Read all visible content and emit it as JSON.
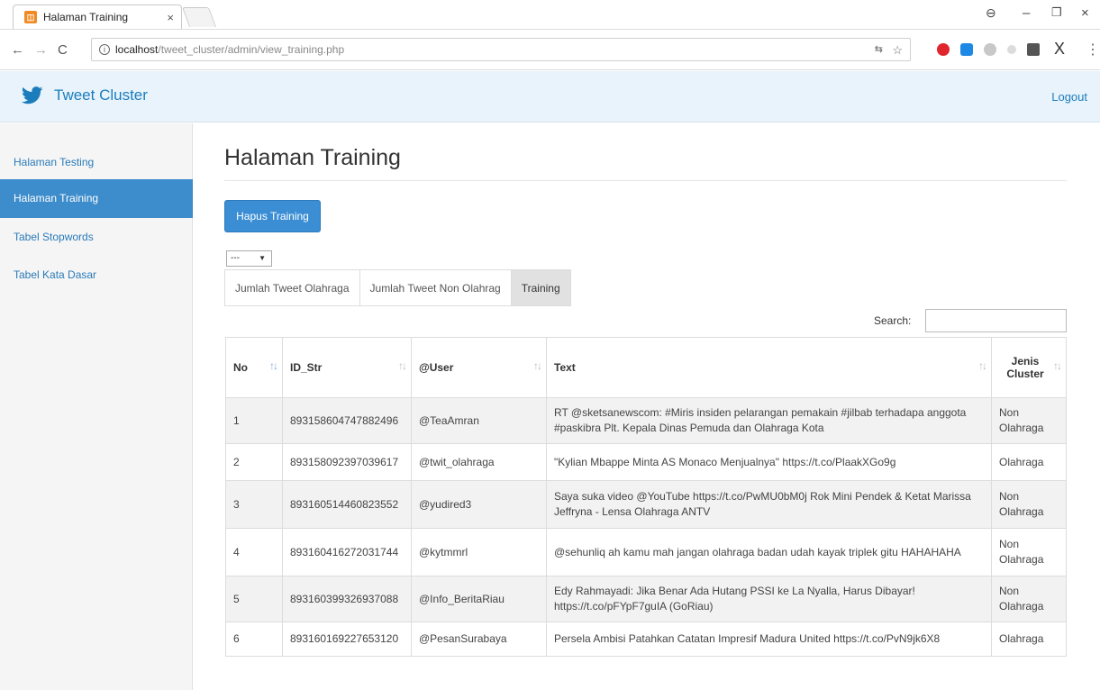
{
  "browser": {
    "tab_title": "Halaman Training",
    "tab_close": "×",
    "url_host": "localhost",
    "url_path": "/tweet_cluster/admin/view_training.php",
    "minimize": "–",
    "maximize": "❐",
    "close": "×"
  },
  "navbar": {
    "brand": "Tweet Cluster",
    "logout": "Logout",
    "brand_color": "#1c7dbd"
  },
  "sidebar": {
    "items": [
      {
        "label": "Halaman Testing",
        "active": false
      },
      {
        "label": "Halaman Training",
        "active": true
      },
      {
        "label": "Tabel Stopwords",
        "active": false
      },
      {
        "label": "Tabel Kata Dasar",
        "active": false
      }
    ]
  },
  "main": {
    "title": "Halaman Training",
    "delete_button": "Hapus Training",
    "select_value": "---",
    "pills": [
      "Jumlah Tweet Olahraga",
      "Jumlah Tweet Non Olahrag",
      "Training"
    ],
    "search_label": "Search:",
    "search_value": ""
  },
  "table": {
    "headers": [
      "No",
      "ID_Str",
      "@User",
      "Text",
      "Jenis Cluster"
    ],
    "rows": [
      [
        "1",
        "893158604747882496",
        "@TeaAmran",
        "RT @sketsanewscom: #Miris insiden pelarangan pemakain #jilbab terhadapa anggota #paskibra Plt. Kepala Dinas Pemuda dan Olahraga Kota",
        "Non Olahraga"
      ],
      [
        "2",
        "893158092397039617",
        "@twit_olahraga",
        "\"Kylian Mbappe Minta AS Monaco Menjualnya\" https://t.co/PlaakXGo9g",
        "Olahraga"
      ],
      [
        "3",
        "893160514460823552",
        "@yudired3",
        "Saya suka video @YouTube https://t.co/PwMU0bM0j Rok Mini Pendek & Ketat Marissa Jeffryna - Lensa Olahraga ANTV",
        "Non Olahraga"
      ],
      [
        "4",
        "893160416272031744",
        "@kytmmrl",
        "@sehunliq ah kamu mah jangan olahraga badan udah kayak triplek gitu HAHAHAHA",
        "Non Olahraga"
      ],
      [
        "5",
        "893160399326937088",
        "@Info_BeritaRiau",
        "Edy Rahmayadi: Jika Benar Ada Hutang PSSI ke La Nyalla, Harus Dibayar! https://t.co/pFYpF7guIA (GoRiau)",
        "Non Olahraga"
      ],
      [
        "6",
        "893160169227653120",
        "@PesanSurabaya",
        "Persela Ambisi Patahkan Catatan Impresif Madura United https://t.co/PvN9jk6X8",
        "Olahraga"
      ]
    ]
  }
}
